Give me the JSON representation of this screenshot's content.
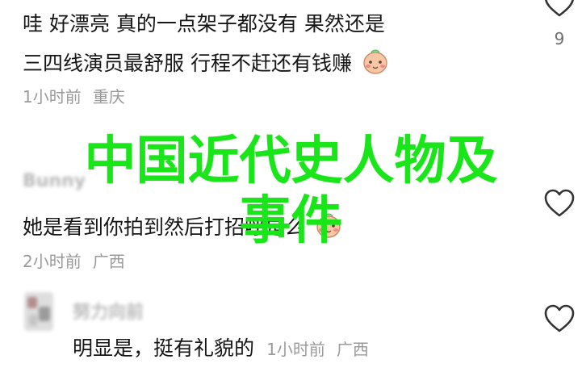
{
  "comments": [
    {
      "line1": "哇 好漂亮 真的一点架子都没有 果然还是",
      "line2": "三四线演员最舒服 行程不赶还有钱赚",
      "time": "1小时前",
      "region": "重庆",
      "likes": "9"
    },
    {
      "author": "Bunny",
      "text": "她是看到你拍到然后打招呼是么",
      "time": "2小时前",
      "region": "广西"
    },
    {
      "author": "努力向前",
      "text": "明显是，挺有礼貌的",
      "time": "1小时前",
      "region": "广西"
    }
  ],
  "watermark": {
    "line1": "中国近代史人物及",
    "line2": "事件",
    "color": "#19e619"
  },
  "icons": {
    "like": "heart-outline-icon",
    "emoji": "blushing-face-emoji"
  }
}
